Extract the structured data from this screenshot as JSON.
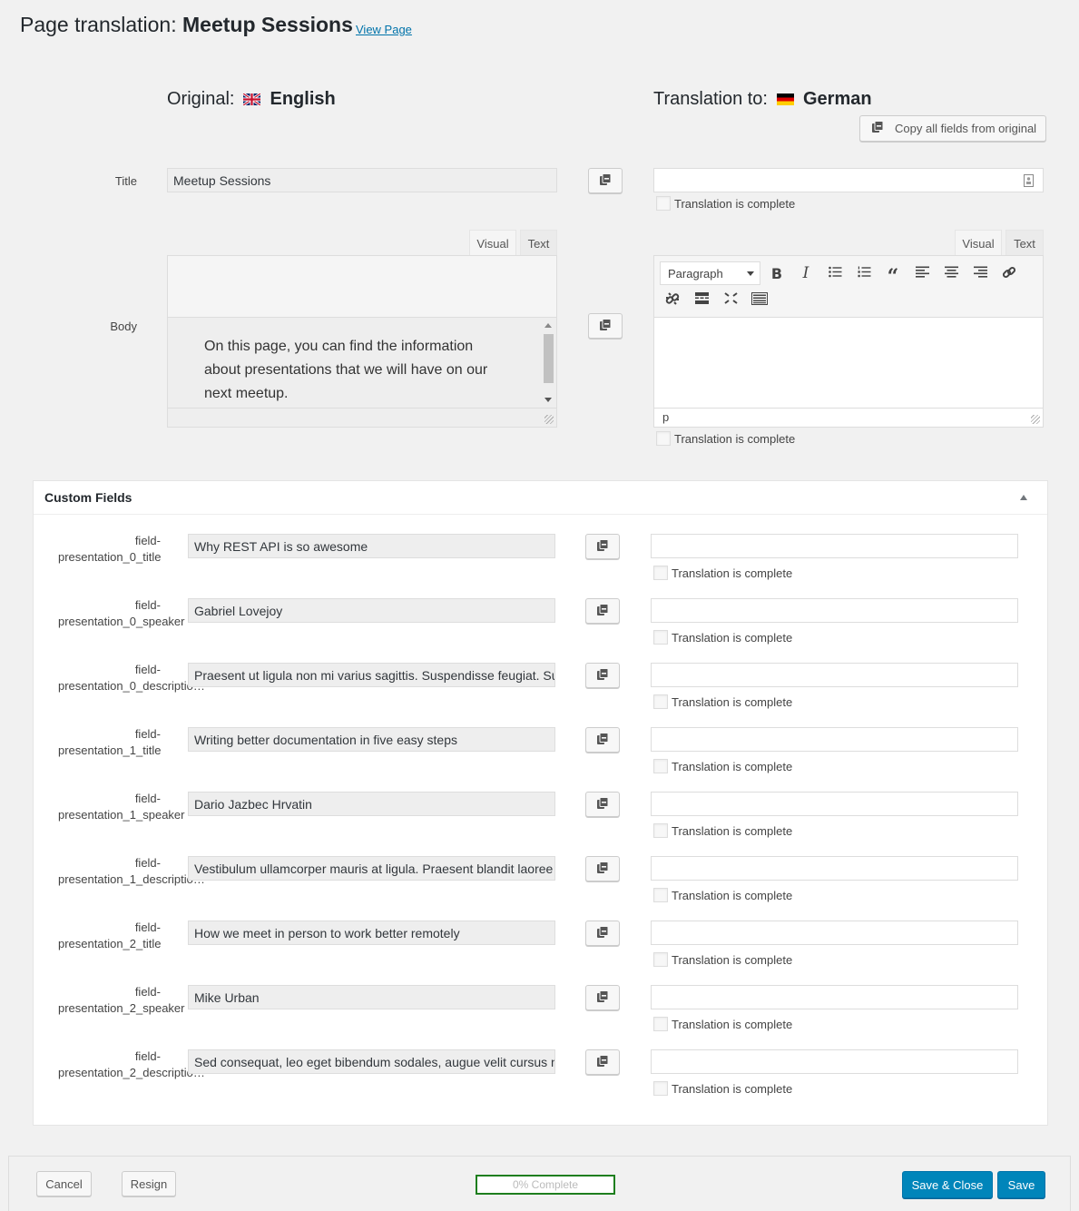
{
  "header": {
    "title_prefix": "Page translation: ",
    "title_name": "Meetup Sessions",
    "view_page_link": "View Page"
  },
  "original": {
    "label": "Original:",
    "language": "English",
    "flag_icon": "uk-flag-icon"
  },
  "translation": {
    "label": "Translation to:",
    "language": "German",
    "flag_icon": "germany-flag-icon",
    "copy_all_label": "Copy all fields from original"
  },
  "title_field": {
    "label": "Title",
    "original_value": "Meetup Sessions",
    "translation_value": "",
    "complete_label": "Translation is complete",
    "complete": false
  },
  "body_field": {
    "label": "Body",
    "original_tabs": [
      "Visual",
      "Text"
    ],
    "translation_tabs": [
      "Visual",
      "Text"
    ],
    "original_value": "On this page, you can find the information about presentations that we will have on our next meetup.",
    "format_select": "Paragraph",
    "toolbar_icons": [
      "bold-icon",
      "italic-icon",
      "bullet-list-icon",
      "numbered-list-icon",
      "blockquote-icon",
      "align-left-icon",
      "align-center-icon",
      "align-right-icon",
      "link-icon",
      "unlink-icon",
      "read-more-icon",
      "fullscreen-icon",
      "keyboard-toolbar-icon"
    ],
    "status_path": "p",
    "complete_label": "Translation is complete",
    "complete": false
  },
  "custom_fields": {
    "title": "Custom Fields",
    "complete_label": "Translation is complete",
    "fields": [
      {
        "label_line1": "field-",
        "label_line2": "presentation_0_title",
        "original": "Why REST API is so awesome",
        "translation": "",
        "complete": false
      },
      {
        "label_line1": "field-",
        "label_line2": "presentation_0_speaker",
        "original": "Gabriel Lovejoy",
        "translation": "",
        "complete": false
      },
      {
        "label_line1": "field-",
        "label_line2": "presentation_0_descriptio…",
        "original": "Praesent ut ligula non mi varius sagittis. Suspendisse feugiat. Su",
        "translation": "",
        "complete": false
      },
      {
        "label_line1": "field-",
        "label_line2": "presentation_1_title",
        "original": "Writing better documentation in five easy steps",
        "translation": "",
        "complete": false
      },
      {
        "label_line1": "field-",
        "label_line2": "presentation_1_speaker",
        "original": "Dario Jazbec Hrvatin",
        "translation": "",
        "complete": false
      },
      {
        "label_line1": "field-",
        "label_line2": "presentation_1_descriptio…",
        "original": "Vestibulum ullamcorper mauris at ligula. Praesent blandit laoree",
        "translation": "",
        "complete": false
      },
      {
        "label_line1": "field-",
        "label_line2": "presentation_2_title",
        "original": "How we meet in person to work better remotely",
        "translation": "",
        "complete": false
      },
      {
        "label_line1": "field-",
        "label_line2": "presentation_2_speaker",
        "original": "Mike Urban",
        "translation": "",
        "complete": false
      },
      {
        "label_line1": "field-",
        "label_line2": "presentation_2_descriptio…",
        "original": "Sed consequat, leo eget bibendum sodales, augue velit cursus n",
        "translation": "",
        "complete": false
      }
    ]
  },
  "footer": {
    "cancel_label": "Cancel",
    "resign_label": "Resign",
    "progress_percent": 0,
    "progress_label": "0% Complete",
    "save_close_label": "Save & Close",
    "save_label": "Save"
  },
  "colors": {
    "primary_button": "#0085ba",
    "link": "#0073aa",
    "progress_border": "#1e7e1e"
  }
}
